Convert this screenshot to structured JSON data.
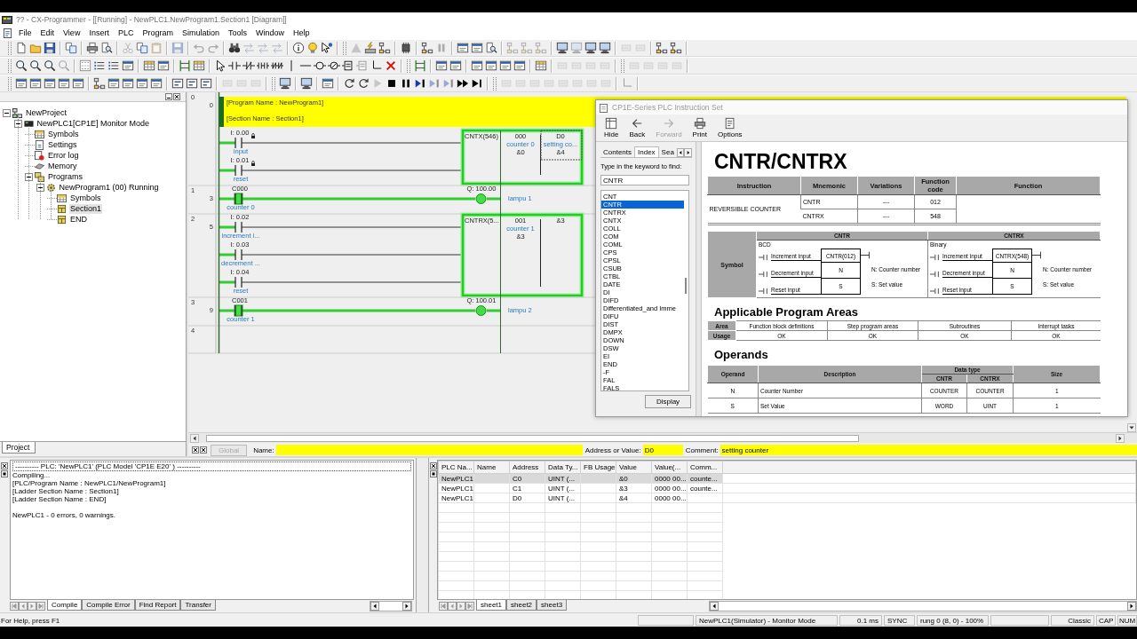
{
  "window": {
    "title": "?? - CX-Programmer - [[Running] - NewPLC1.NewProgram1.Section1 [Diagram]]"
  },
  "menu": [
    "File",
    "Edit",
    "View",
    "Insert",
    "PLC",
    "Program",
    "Simulation",
    "Tools",
    "Window",
    "Help"
  ],
  "project_tree": {
    "tab": "Project",
    "items": [
      {
        "label": "NewProject",
        "kind": "project",
        "expanded": true,
        "selected": false,
        "children": [
          {
            "label": "NewPLC1[CP1E] Monitor Mode",
            "kind": "plc",
            "expanded": true,
            "selected": false,
            "children": [
              {
                "label": "Symbols",
                "kind": "symbols",
                "selected": false
              },
              {
                "label": "Settings",
                "kind": "settings",
                "selected": false
              },
              {
                "label": "Error log",
                "kind": "errorlog",
                "selected": false
              },
              {
                "label": "Memory",
                "kind": "memory",
                "selected": false
              },
              {
                "label": "Programs",
                "kind": "programs",
                "expanded": true,
                "selected": false,
                "children": [
                  {
                    "label": "NewProgram1 (00) Running",
                    "kind": "program",
                    "expanded": true,
                    "selected": false,
                    "children": [
                      {
                        "label": "Symbols",
                        "kind": "symbols",
                        "selected": false
                      },
                      {
                        "label": "Section1",
                        "kind": "section",
                        "selected": true
                      },
                      {
                        "label": "END",
                        "kind": "section",
                        "selected": false
                      }
                    ]
                  }
                ]
              }
            ]
          }
        ]
      }
    ]
  },
  "ladder": {
    "rungs": [
      {
        "number": "0",
        "step": "0",
        "comment": [
          "[Program Name : NewProgram1]",
          "[Section Name : Section1]"
        ],
        "contacts": [
          {
            "address": "I: 0.00",
            "label": "input",
            "on": false,
            "marked": true
          },
          {
            "address": "I: 0.01",
            "label": "reset",
            "on": false,
            "marked": true
          }
        ],
        "instruction": {
          "name": "CNTX(546)",
          "on": true,
          "operands": [
            {
              "address": "000",
              "comment": "counter 0",
              "value": "&0",
              "selected": false
            },
            {
              "address": "D0",
              "comment": "setting co...",
              "value": "&4",
              "selected": true
            }
          ]
        }
      },
      {
        "number": "1",
        "step": "3",
        "contacts": [
          {
            "address": "C000",
            "label": "counter 0",
            "on": true,
            "marked": false
          }
        ],
        "coil": {
          "address": "Q: 100.00",
          "label": "lampu 1",
          "on": true
        }
      },
      {
        "number": "2",
        "step": "5",
        "contacts": [
          {
            "address": "I: 0.02",
            "label": "increment i...",
            "on": false,
            "marked": false
          },
          {
            "address": "I: 0.03",
            "label": "decrement ...",
            "on": false,
            "marked": false
          },
          {
            "address": "I: 0.04",
            "label": "reset",
            "on": false,
            "marked": false
          }
        ],
        "instruction": {
          "name": "CNTRX(5...",
          "on": true,
          "operands": [
            {
              "address": "001",
              "comment": "counter 1",
              "value": "&3",
              "selected": false
            },
            {
              "address": "&3",
              "selected": false
            }
          ]
        }
      },
      {
        "number": "3",
        "step": "9",
        "contacts": [
          {
            "address": "C001",
            "label": "counter 1",
            "on": true,
            "marked": false
          }
        ],
        "coil": {
          "address": "Q: 100.01",
          "label": "lampu 2",
          "on": true
        }
      },
      {
        "number": "4"
      }
    ]
  },
  "help_window": {
    "title": "CP1E-Series PLC Instruction Set",
    "toolbar": [
      {
        "label": "Hide",
        "disabled": false
      },
      {
        "label": "Back",
        "disabled": false
      },
      {
        "label": "Forward",
        "disabled": true
      },
      {
        "label": "Print",
        "disabled": false
      },
      {
        "label": "Options",
        "disabled": false
      }
    ],
    "tabs": [
      {
        "label": "Contents",
        "selected": false
      },
      {
        "label": "Index",
        "selected": true
      },
      {
        "label": "Sea",
        "selected": false
      }
    ],
    "keyword_label": "Type in the keyword to find:",
    "keyword": "CNTR",
    "index_items": [
      {
        "label": "CNT",
        "selected": false
      },
      {
        "label": "CNTR",
        "selected": true
      },
      {
        "label": "CNTRX",
        "selected": false
      },
      {
        "label": "CNTX",
        "selected": false
      },
      {
        "label": "COLL",
        "selected": false
      },
      {
        "label": "COM",
        "selected": false
      },
      {
        "label": "COML",
        "selected": false
      },
      {
        "label": "CPS",
        "selected": false
      },
      {
        "label": "CPSL",
        "selected": false
      },
      {
        "label": "CSUB",
        "selected": false
      },
      {
        "label": "CTBL",
        "selected": false
      },
      {
        "label": "DATE",
        "selected": false
      },
      {
        "label": "DI",
        "selected": false
      },
      {
        "label": "DIFD",
        "selected": false
      },
      {
        "label": "Differentiated_and Imme",
        "selected": false
      },
      {
        "label": "DIFU",
        "selected": false
      },
      {
        "label": "DIST",
        "selected": false
      },
      {
        "label": "DMPX",
        "selected": false
      },
      {
        "label": "DOWN",
        "selected": false
      },
      {
        "label": "DSW",
        "selected": false
      },
      {
        "label": "EI",
        "selected": false
      },
      {
        "label": "END",
        "selected": false
      },
      {
        "label": "-F",
        "selected": false
      },
      {
        "label": "FAL",
        "selected": false
      },
      {
        "label": "FALS",
        "selected": false
      }
    ],
    "display_button": "Display",
    "topic": {
      "heading": "CNTR/CNTRX",
      "summary": {
        "columns": [
          "Instruction",
          "Mnemonic",
          "Variations",
          "Function code",
          "Function"
        ],
        "rows": [
          [
            {
              "text": "REVERSIBLE COUNTER",
              "rowspan": 2
            },
            "CNTR",
            "---",
            "012"
          ],
          [
            "CNTRX",
            "---",
            "548"
          ]
        ]
      },
      "symbol": {
        "label": "Symbol",
        "variants": [
          {
            "name": "CNTR",
            "mode": "BCD",
            "box": "CNTR(012)",
            "inputs": [
              "Increment input",
              "Decrement input",
              "Reset input"
            ],
            "operands": [
              "N",
              "S"
            ],
            "notes": [
              "N: Counter number",
              "S: Set value"
            ]
          },
          {
            "name": "CNTRX",
            "mode": "Binary",
            "box": "CNTRX(548)",
            "inputs": [
              "Increment input",
              "Decrement input",
              "Reset input"
            ],
            "operands": [
              "N",
              "S"
            ],
            "notes": [
              "N: Counter number",
              "S: Set value"
            ]
          }
        ]
      },
      "areas": {
        "heading": "Applicable Program Areas",
        "row_labels": [
          "Area",
          "Usage"
        ],
        "columns": [
          "Function block definitions",
          "Step program areas",
          "Subroutines",
          "Interrupt tasks"
        ],
        "usage": [
          "OK",
          "OK",
          "OK",
          "OK"
        ]
      },
      "operands": {
        "heading": "Operands",
        "columns": [
          {
            "label": "Operand"
          },
          {
            "label": "Description"
          },
          {
            "label": "Data type",
            "colspan": 2,
            "subcolumns": [
              "CNTR",
              "CNTRX"
            ]
          },
          {
            "label": "Size"
          }
        ],
        "rows": [
          [
            "N",
            "Counter Number",
            "COUNTER",
            "COUNTER",
            "1"
          ],
          [
            "S",
            "Set Value",
            "WORD",
            "UINT",
            "1"
          ]
        ]
      }
    }
  },
  "field_bar": {
    "tab": {
      "label": "Global",
      "disabled": true
    },
    "name": {
      "label": "Name:"
    },
    "address": {
      "label": "Address or Value:",
      "value": "D0"
    },
    "comment": {
      "label": "Comment:",
      "value": "setting counter"
    }
  },
  "output": {
    "header": "---------- PLC: 'NewPLC1' (PLC Model 'CP1E E20' ) ----------",
    "lines": [
      "Compiling...",
      "[PLC/Program Name : NewPLC1/NewProgram1]",
      "[Ladder Section Name : Section1]",
      "[Ladder Section Name : END]"
    ],
    "summary": "NewPLC1 - 0 errors, 0 warnings.",
    "tabs": [
      {
        "label": "Compile",
        "selected": true
      },
      {
        "label": "Compile Error",
        "selected": false
      },
      {
        "label": "Find Report",
        "selected": false
      },
      {
        "label": "Transfer",
        "selected": false
      }
    ]
  },
  "watch": {
    "columns": [
      "PLC Na...",
      "Name",
      "Address",
      "Data Ty...",
      "FB Usage",
      "Value",
      "Value(...",
      "Comm..."
    ],
    "rows": [
      {
        "cells": [
          "NewPLC1",
          null,
          "C0",
          "UINT (...",
          null,
          "&0",
          "0000 00...",
          "counte..."
        ],
        "selected": true
      },
      {
        "cells": [
          "NewPLC1",
          null,
          "C1",
          "UINT (...",
          null,
          "&3",
          "0000 00...",
          "counte..."
        ],
        "selected": false
      },
      {
        "cells": [
          "NewPLC1",
          null,
          "D0",
          "UINT (...",
          null,
          "&4",
          "0000 00...",
          null
        ],
        "selected": false
      }
    ],
    "tabs": [
      {
        "label": "sheet1",
        "selected": true
      },
      {
        "label": "sheet2",
        "selected": false
      },
      {
        "label": "sheet3",
        "selected": false
      }
    ]
  },
  "status_bar": {
    "help": "For Help, press F1",
    "panes": [
      "NewPLC1(Simulator) - Monitor Mode",
      "0.1 ms",
      "SYNC",
      "rung 0 (8, 0) - 100%",
      "Classic",
      "CAP",
      "NUM"
    ]
  }
}
